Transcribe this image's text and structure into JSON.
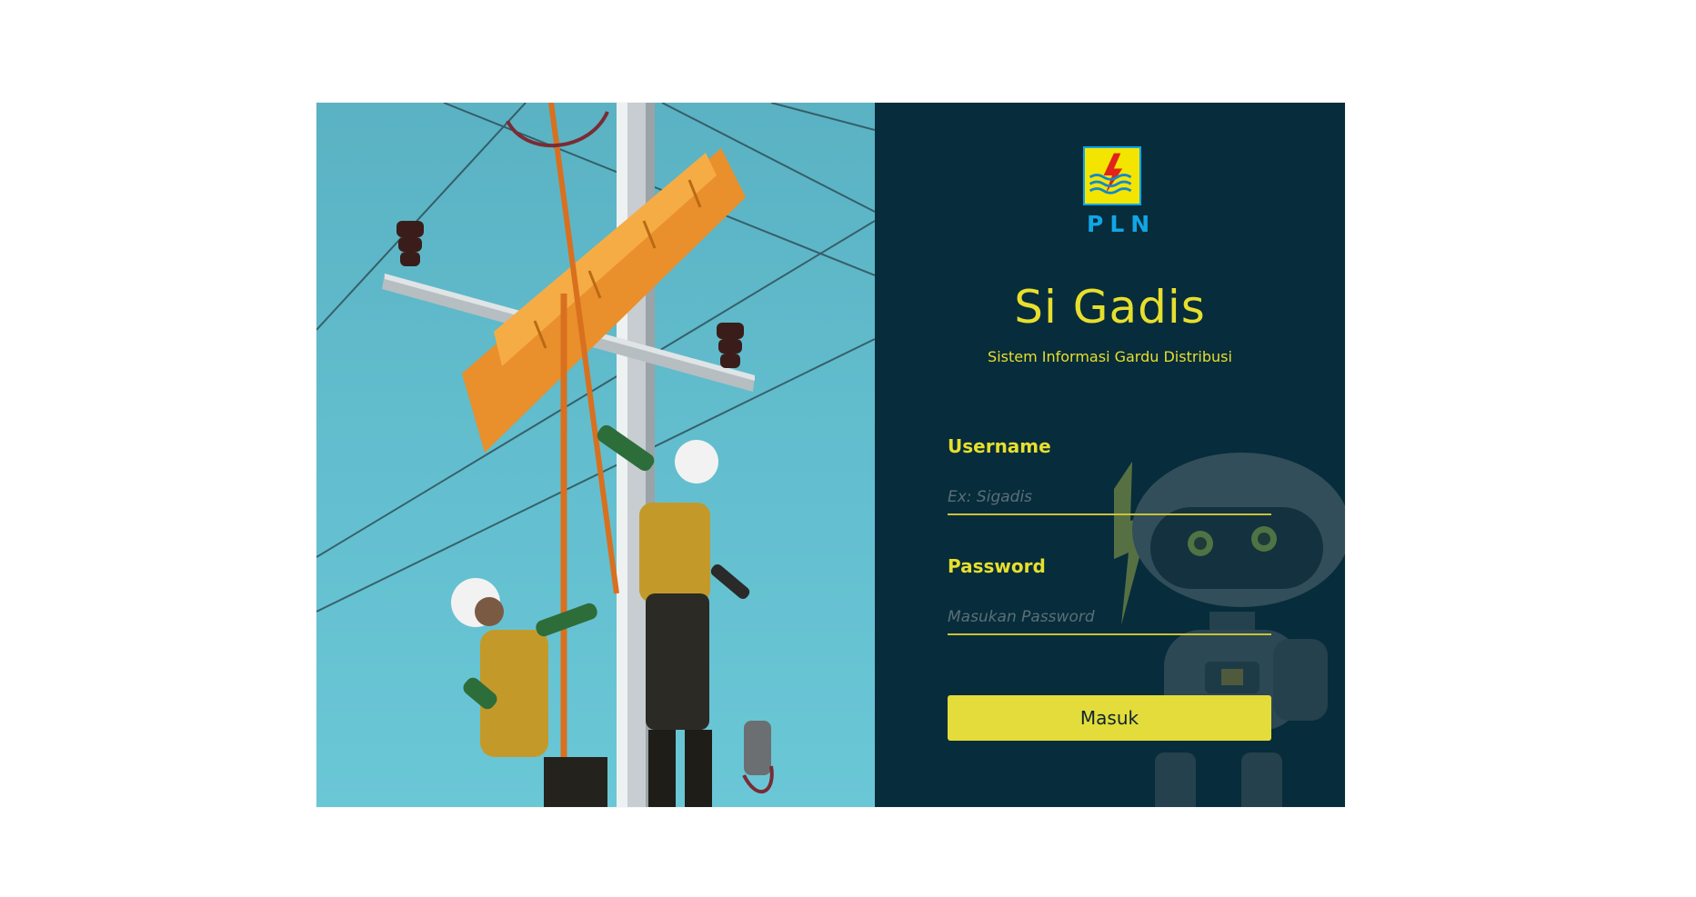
{
  "brand": {
    "logo_text": "PLN",
    "logo_icon": "pln-logo-icon",
    "colors": {
      "logo_yellow": "#f4e500",
      "logo_blue": "#10a6e6",
      "accent_yellow": "#e7df2d",
      "panel_bg": "#072c3b",
      "button_bg": "#e4dc3a"
    }
  },
  "app": {
    "title": "Si Gadis",
    "subtitle": "Sistem Informasi Gardu Distribusi"
  },
  "login": {
    "username_label": "Username",
    "username_placeholder": "Ex: Sigadis",
    "password_label": "Password",
    "password_placeholder": "Masukan Password",
    "submit_label": "Masuk"
  },
  "hero": {
    "image": "line-workers-on-power-pole"
  },
  "decoration": {
    "mascot": "robot-mascot"
  }
}
